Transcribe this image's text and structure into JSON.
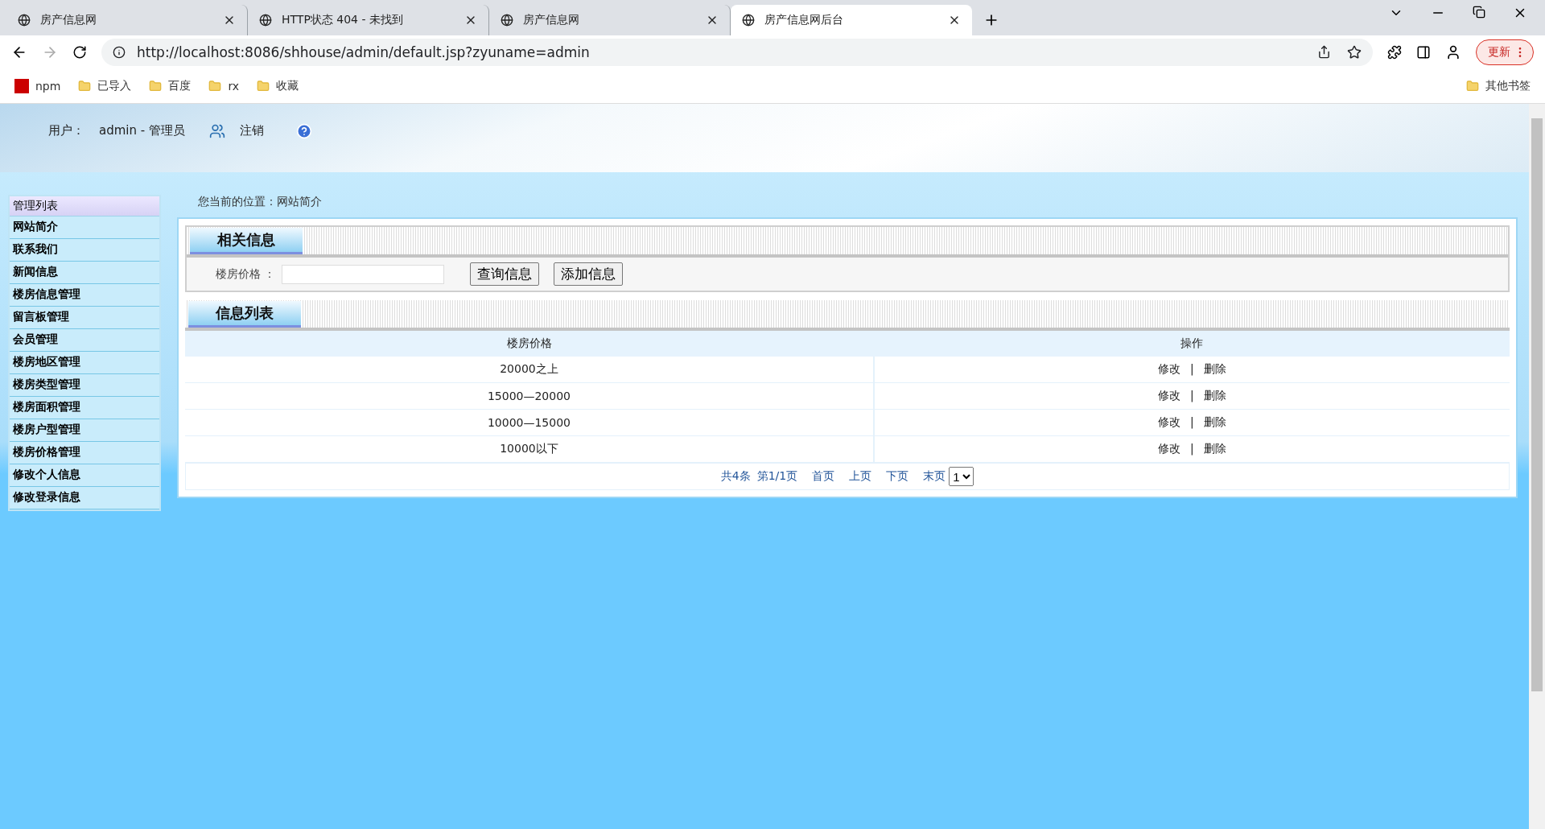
{
  "browser": {
    "tabs": [
      {
        "title": "房产信息网",
        "selected": false
      },
      {
        "title": "HTTP状态 404 - 未找到",
        "selected": false
      },
      {
        "title": "房产信息网",
        "selected": false
      },
      {
        "title": "房产信息网后台",
        "selected": true
      }
    ],
    "url": "http://localhost:8086/shhouse/admin/default.jsp?zyuname=admin",
    "update_label": "更新",
    "bookmarks": [
      {
        "label": "npm",
        "kind": "logo"
      },
      {
        "label": "已导入",
        "kind": "folder"
      },
      {
        "label": "百度",
        "kind": "folder"
      },
      {
        "label": "rx",
        "kind": "folder"
      },
      {
        "label": "收藏",
        "kind": "folder"
      }
    ],
    "other_bookmarks": "其他书签"
  },
  "header": {
    "user_label": "用户：",
    "user_value": "admin - 管理员",
    "logout": "注销"
  },
  "sidebar": {
    "title": "管理列表",
    "items": [
      {
        "label": "网站简介"
      },
      {
        "label": "联系我们"
      },
      {
        "label": "新闻信息"
      },
      {
        "label": "楼房信息管理"
      },
      {
        "label": "留言板管理"
      },
      {
        "label": "会员管理"
      },
      {
        "label": "楼房地区管理"
      },
      {
        "label": "楼房类型管理"
      },
      {
        "label": "楼房面积管理"
      },
      {
        "label": "楼房户型管理"
      },
      {
        "label": "楼房价格管理"
      },
      {
        "label": "修改个人信息"
      },
      {
        "label": "修改登录信息"
      }
    ]
  },
  "breadcrumb": "您当前的位置：网站简介",
  "search_section": {
    "title": "相关信息",
    "field_label": "楼房价格 ：",
    "buttons": [
      "查询信息",
      "添加信息"
    ]
  },
  "list_section": {
    "title": "信息列表",
    "columns": [
      "楼房价格",
      "操作"
    ],
    "rows": [
      {
        "price": "20000之上",
        "edit": "修改",
        "separator": "|",
        "delete": "删除"
      },
      {
        "price": "15000—20000",
        "edit": "修改",
        "separator": "|",
        "delete": "删除"
      },
      {
        "price": "10000—15000",
        "edit": "修改",
        "separator": "|",
        "delete": "删除"
      },
      {
        "price": "10000以下",
        "edit": "修改",
        "separator": "|",
        "delete": "删除"
      }
    ],
    "pagination": {
      "total": "共4条",
      "page": "第1/1页",
      "links": [
        "首页",
        "上页",
        "下页",
        "末页"
      ],
      "page_select": "1"
    }
  }
}
